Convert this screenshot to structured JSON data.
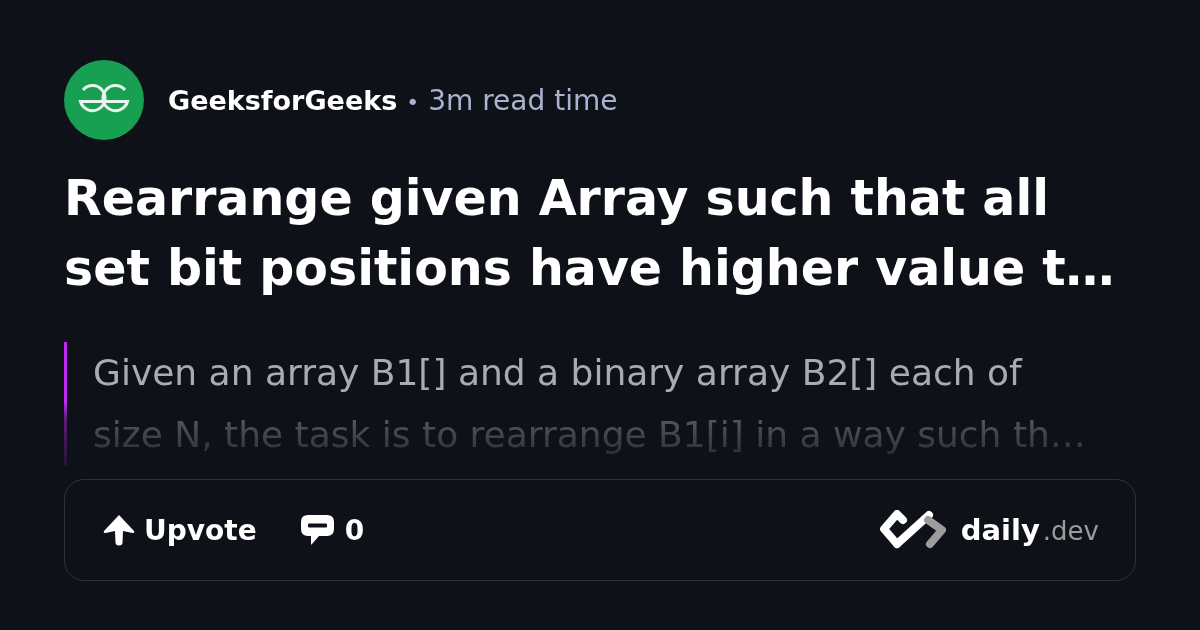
{
  "source": {
    "name": "GeeksforGeeks",
    "separator": "•",
    "read_time": "3m read time"
  },
  "title": "Rearrange given Array such that all set bit positions have higher value t…",
  "summary": "Given an array B1[] and a binary array B2[] each of size N, the task is to rearrange B1[i] in a way such th…",
  "actions": {
    "upvote": "Upvote",
    "comments": "0"
  },
  "brand": {
    "name": "daily",
    "suffix": ".dev"
  }
}
